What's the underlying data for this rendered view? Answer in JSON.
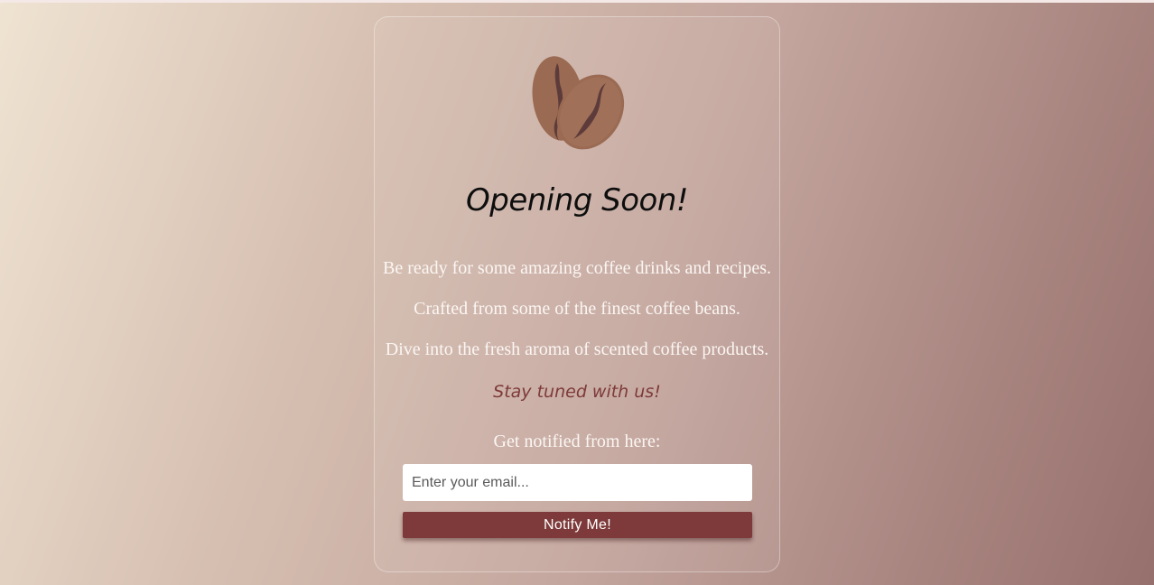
{
  "page": {
    "title": "Opening Soon!",
    "lines": [
      "Be ready for some amazing coffee drinks and recipes.",
      "Crafted from some of the finest coffee beans.",
      "Dive into the fresh aroma of scented coffee products."
    ],
    "tagline": "Stay tuned with us!",
    "notify_label": "Get notified from here:"
  },
  "form": {
    "email_placeholder": "Enter your email...",
    "email_value": "",
    "button_label": "Notify Me!"
  },
  "logo": {
    "icon": "coffee-beans-icon"
  },
  "colors": {
    "accent": "#7e3a3a",
    "bean": "#9a6a52",
    "bean_crease": "#5e3b3b",
    "text_light": "#fbf6f3",
    "title": "#0e0e0e"
  }
}
